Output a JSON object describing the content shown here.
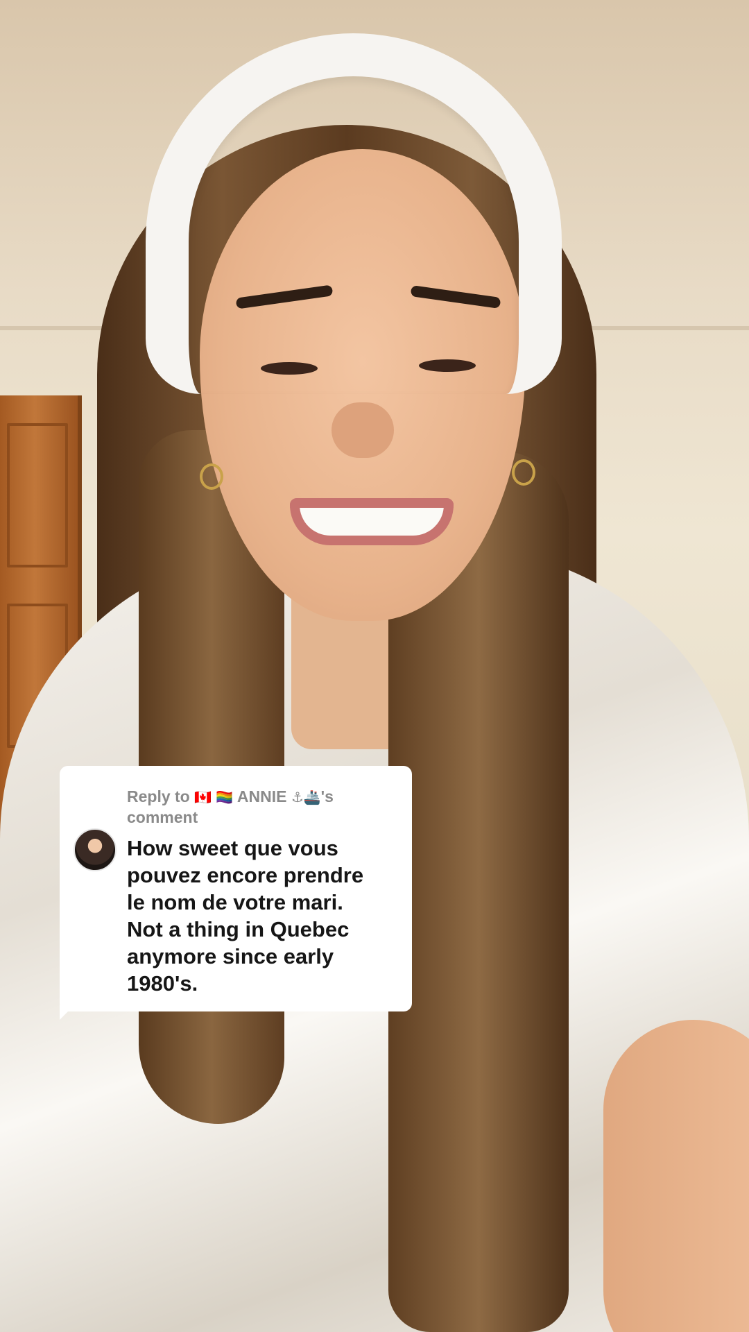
{
  "reply_sticker": {
    "prefix": "Reply to",
    "flag_1": "🇨🇦",
    "flag_2": "🏳️‍🌈",
    "username": "ANNIE",
    "emoji_1": "⚓",
    "emoji_2": "🚢",
    "suffix": "'s",
    "suffix_line": "comment",
    "comment_text": "How sweet que vous\npouvez encore prendre\nle nom de votre mari.\nNot a thing in Quebec\nanymore since early\n1980's.",
    "avatar_icon": "commenter-avatar",
    "background_color": "#ffffff",
    "header_color": "#8a8a8a",
    "text_color": "#161616"
  }
}
